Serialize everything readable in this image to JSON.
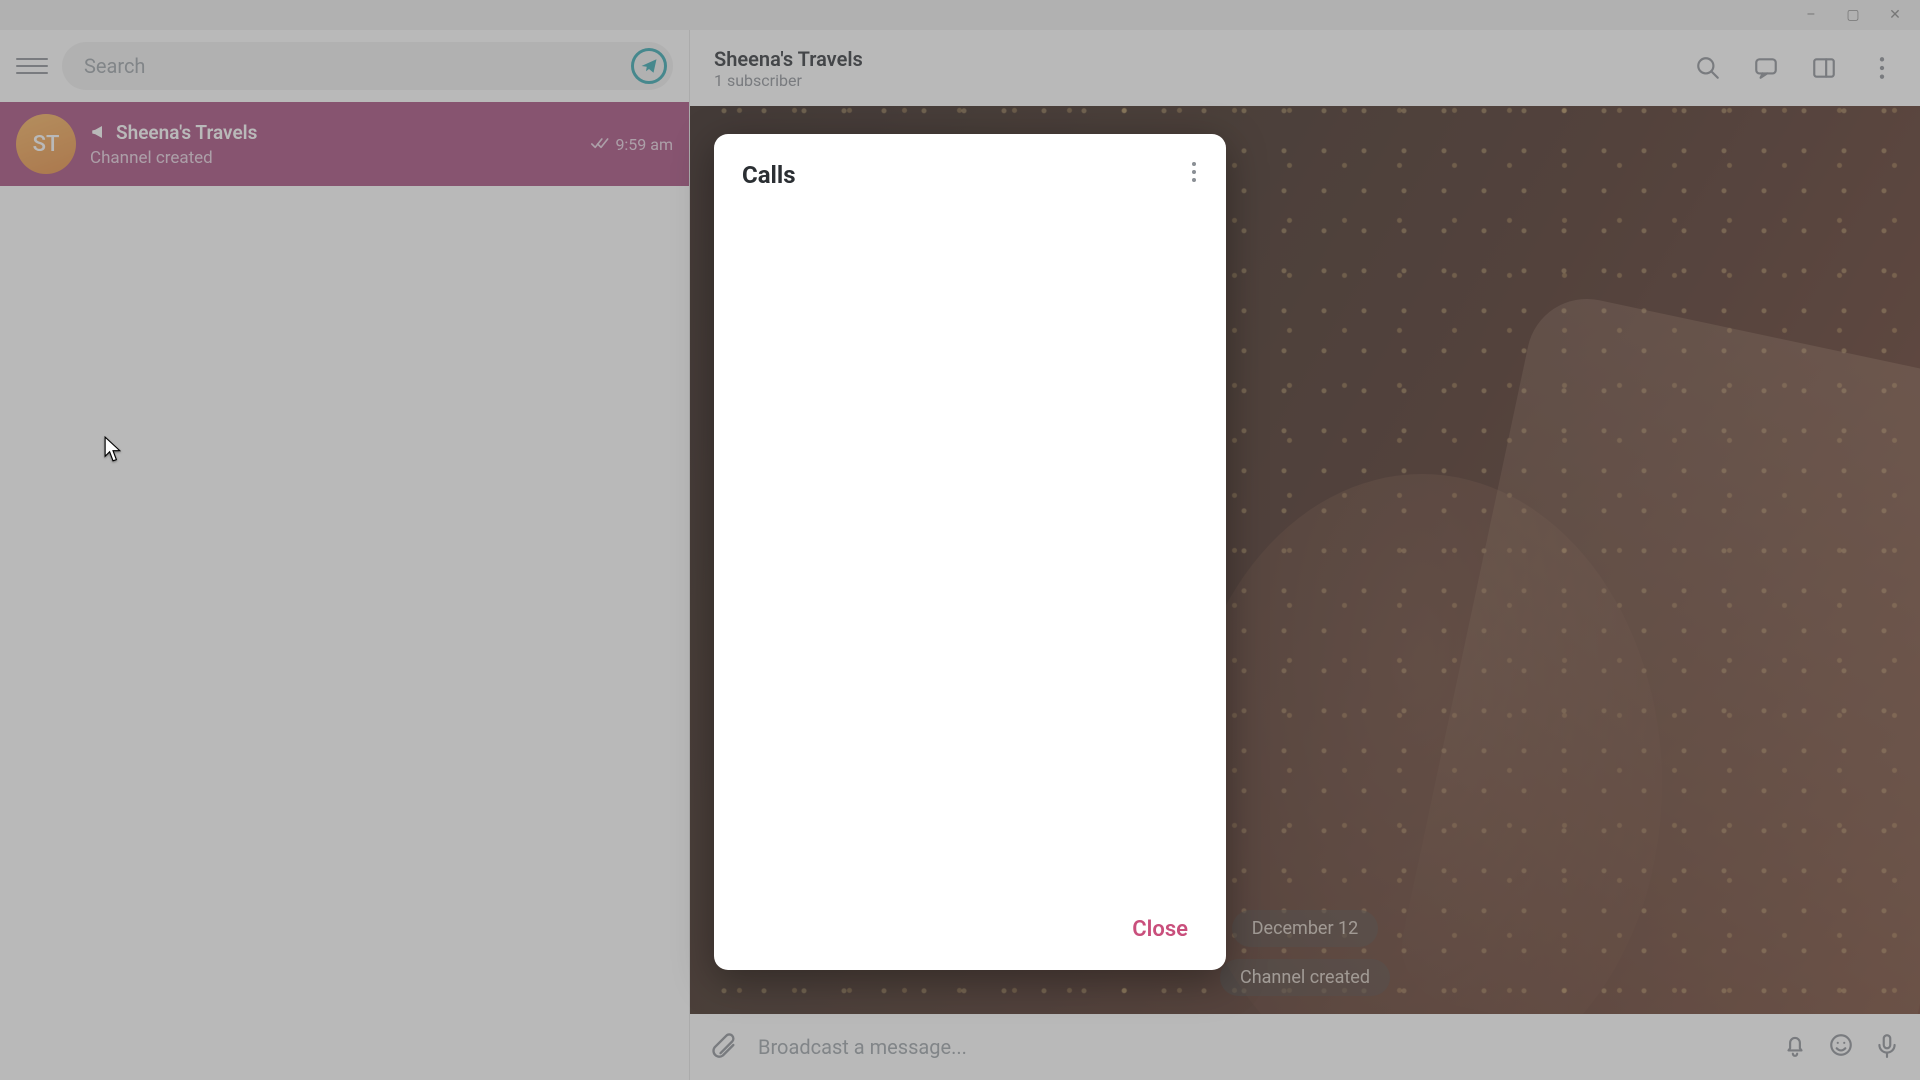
{
  "window": {
    "minimize": "–",
    "maximize": "▢",
    "close": "✕"
  },
  "sidebar": {
    "search_placeholder": "Search",
    "chat": {
      "avatar_initials": "ST",
      "name": "Sheena's Travels",
      "subtitle": "Channel created",
      "time": "9:59 am"
    }
  },
  "header": {
    "title": "Sheena's Travels",
    "subtitle": "1 subscriber"
  },
  "chat": {
    "date_label": "December 12",
    "system_msg": "Channel created"
  },
  "composer": {
    "placeholder": "Broadcast a message..."
  },
  "modal": {
    "title": "Calls",
    "close": "Close"
  }
}
